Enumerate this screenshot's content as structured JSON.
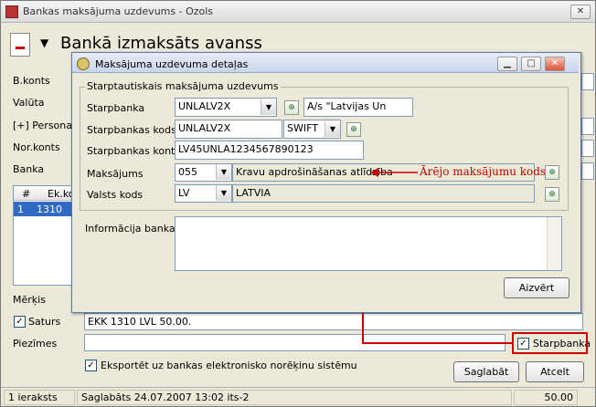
{
  "window": {
    "title": "Bankas maksājuma uzdevums - Ozols",
    "heading": "Bankā izmaksāts avanss"
  },
  "main_labels": {
    "b_konts": "B.konts",
    "valuta": "Valūta",
    "persona": "[+] Persona",
    "nor_konts": "Nor.konts",
    "banka": "Banka",
    "merkis": "Mērķis",
    "saturs": "Saturs",
    "piezimes": "Piezīmes"
  },
  "grid": {
    "headers": [
      "#",
      "Ek.ko"
    ],
    "row": {
      "num": "1",
      "code": "1310"
    }
  },
  "saturs_value": "EKK 1310 LVL 50.00.",
  "checkboxes": {
    "saturs_checked": "✓",
    "starpbanka_label": "Starpbanka",
    "starpbanka_checked": "✓",
    "export_label": "Eksportēt uz bankas elektronisko norēķinu sistēmu",
    "export_checked": "✓"
  },
  "buttons": {
    "save": "Saglabāt",
    "cancel": "Atcelt"
  },
  "status": {
    "records": "1 ieraksts",
    "saved": "Saglabāts 24.07.2007 13:02 its-2",
    "amount": "50.00"
  },
  "dialog": {
    "title": "Maksājuma uzdevuma detaļas",
    "group_title": "Starptautiskais maksājuma uzdevums",
    "starpbanka_label": "Starpbanka",
    "starpbanka_value": "UNLALV2X",
    "starpbanka_name": "A/s \"Latvijas Un",
    "kods_label": "Starpbankas kods",
    "kods_value": "UNLALV2X",
    "kods_type": "SWIFT",
    "konts_label": "Starpbankas konts",
    "konts_value": "LV45UNLA1234567890123",
    "maksajums_label": "Maksājums",
    "maksajums_code": "055",
    "maksajums_desc": "Kravu apdrošināšanas atlīdzība",
    "annotation": "Ārējo maksājumu kods",
    "valsts_label": "Valsts kods",
    "valsts_code": "LV",
    "valsts_name": "LATVIA",
    "info_label": "Informācija bankai",
    "close_button": "Aizvērt"
  },
  "colors": {
    "highlight": "#cc0000",
    "selection": "#316ac5"
  },
  "icons": [
    "app-icon",
    "document-icon",
    "dropdown-arrow-icon",
    "lookup-icon",
    "minimize-icon",
    "maximize-icon",
    "close-icon",
    "checkmark-icon"
  ]
}
